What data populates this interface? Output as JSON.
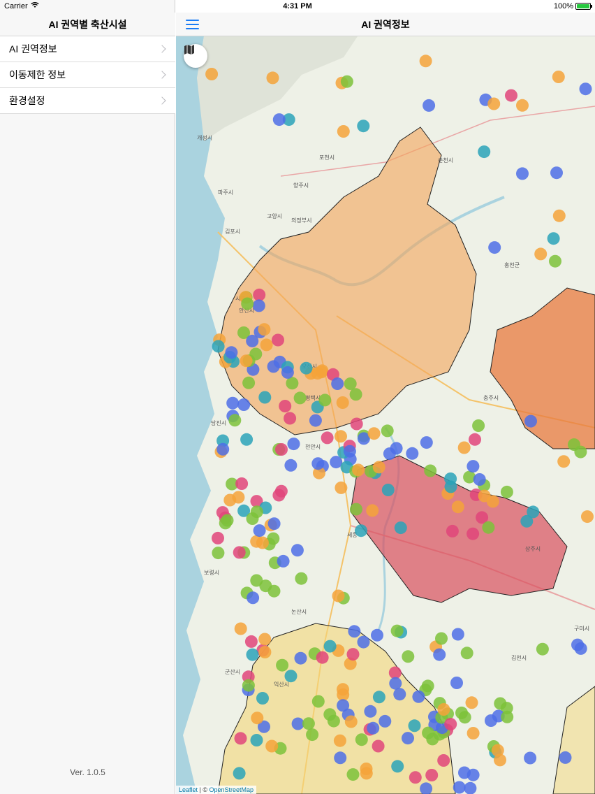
{
  "status_bar": {
    "carrier": "Carrier",
    "time": "4:31 PM",
    "battery": "100%"
  },
  "sidebar": {
    "title": "AI 권역별 축산시설",
    "items": [
      {
        "label": "AI 권역정보"
      },
      {
        "label": "이동제한 정보"
      },
      {
        "label": "환경설정"
      }
    ],
    "version": "Ver. 1.0.5"
  },
  "main": {
    "title": "AI 권역정보"
  },
  "map": {
    "attribution_leaflet": "Leaflet",
    "attribution_sep": " | © ",
    "attribution_osm": "OpenStreetMap",
    "places": [
      {
        "name": "개성시"
      },
      {
        "name": "파주시"
      },
      {
        "name": "고양시"
      },
      {
        "name": "김포시"
      },
      {
        "name": "의정부시"
      },
      {
        "name": "양주시"
      },
      {
        "name": "포천시"
      },
      {
        "name": "춘천시"
      },
      {
        "name": "홍천군"
      },
      {
        "name": "시흥시"
      },
      {
        "name": "안산시"
      },
      {
        "name": "오산시"
      },
      {
        "name": "평택시"
      },
      {
        "name": "당진시"
      },
      {
        "name": "천안시"
      },
      {
        "name": "충주시"
      },
      {
        "name": "세종"
      },
      {
        "name": "보령시"
      },
      {
        "name": "논산시"
      },
      {
        "name": "군산시"
      },
      {
        "name": "김천시"
      },
      {
        "name": "구미시"
      },
      {
        "name": "상주시"
      },
      {
        "name": "익산시"
      }
    ],
    "marker_colors": {
      "green": "#7cc23a",
      "blue": "#4d6fe6",
      "orange": "#f5a33a",
      "pink": "#e0457a",
      "teal": "#2aa3b8"
    },
    "region_colors": {
      "orange": "#f4a55a",
      "red": "#d9505e",
      "yellow": "#f3d77a",
      "deep_orange": "#e8793f"
    }
  }
}
